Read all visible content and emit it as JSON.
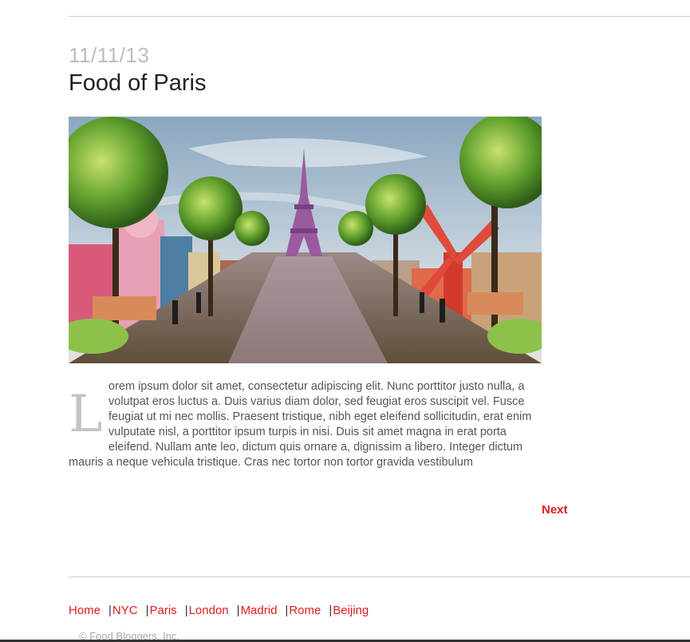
{
  "post": {
    "date": "11/11/13",
    "title": "Food of Paris",
    "dropcap": "L",
    "body": "orem ipsum dolor sit amet, consectetur adipiscing elit. Nunc porttitor justo nulla, a volutpat eros luctus a. Duis varius diam dolor, sed feugiat eros suscipit vel. Fusce feugiat ut mi nec mollis. Praesent tristique, nibh eget eleifend sollicitudin, erat enim vulputate nisl, a porttitor ipsum turpis in nisi. Duis sit amet magna in erat porta eleifend. Nullam ante leo, dictum quis ornare a, dignissim a libero. Integer dictum mauris a neque vehicula tristique. Cras nec tortor non tortor gravida vestibulum"
  },
  "pager": {
    "next_label": "Next"
  },
  "footer": {
    "nav": [
      {
        "label": "Home"
      },
      {
        "label": "NYC"
      },
      {
        "label": "Paris"
      },
      {
        "label": "London"
      },
      {
        "label": "Madrid"
      },
      {
        "label": "Rome"
      },
      {
        "label": "Beijing"
      }
    ],
    "separator": "|",
    "copyright": "© Food Bloggers, Inc."
  },
  "colors": {
    "accent": "#e01b1b",
    "date_gray": "#bdbdbd",
    "rule_gray": "#cfcfcf"
  }
}
